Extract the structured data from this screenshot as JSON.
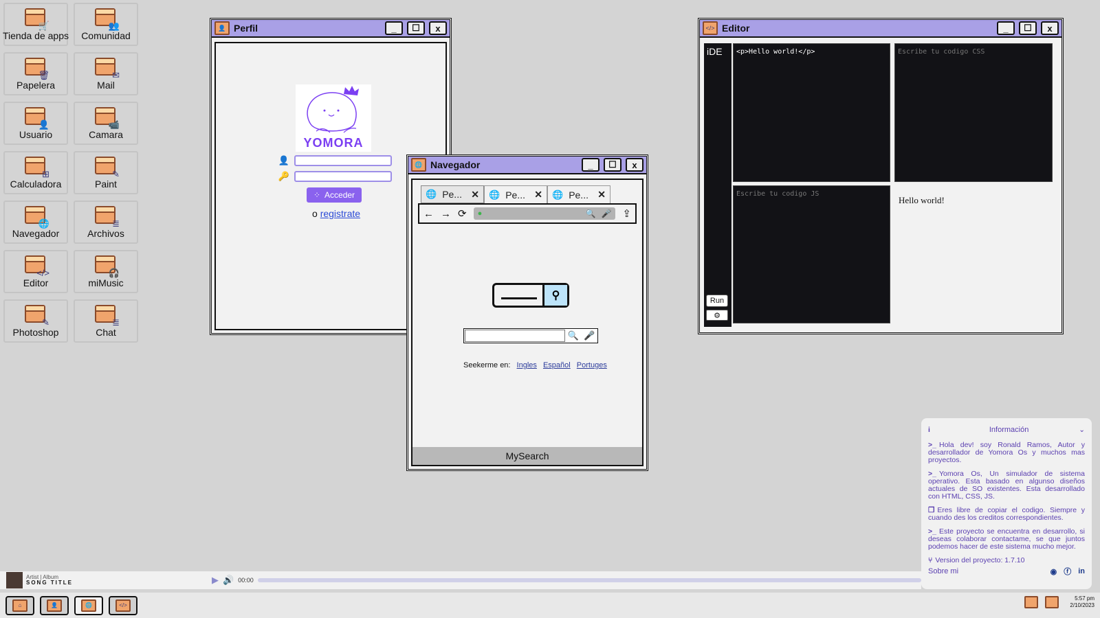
{
  "desktop": {
    "icons": [
      {
        "label": "Tienda de apps",
        "icon": "cart-icon",
        "glyph": "🛒"
      },
      {
        "label": "Comunidad",
        "icon": "community-icon",
        "glyph": "👥"
      },
      {
        "label": "Papelera",
        "icon": "trash-icon",
        "glyph": "🗑"
      },
      {
        "label": "Mail",
        "icon": "mail-icon",
        "glyph": "✉"
      },
      {
        "label": "Usuario",
        "icon": "user-icon",
        "glyph": "👤"
      },
      {
        "label": "Camara",
        "icon": "camera-icon",
        "glyph": "📹"
      },
      {
        "label": "Calculadora",
        "icon": "calculator-icon",
        "glyph": "⊞"
      },
      {
        "label": "Paint",
        "icon": "paint-icon",
        "glyph": "✎"
      },
      {
        "label": "Navegador",
        "icon": "browser-icon",
        "glyph": "🌐"
      },
      {
        "label": "Archivos",
        "icon": "files-icon",
        "glyph": "≣"
      },
      {
        "label": "Editor",
        "icon": "code-icon",
        "glyph": "</>"
      },
      {
        "label": "miMusic",
        "icon": "headphones-icon",
        "glyph": "🎧"
      },
      {
        "label": "Photoshop",
        "icon": "brush-icon",
        "glyph": "✎"
      },
      {
        "label": "Chat",
        "icon": "chat-icon",
        "glyph": "≣"
      }
    ]
  },
  "perfil": {
    "title": "Perfil",
    "logo_text": "YOMORA",
    "login_button": "Acceder",
    "register_prefix": "o",
    "register_link": "registrate"
  },
  "navegador": {
    "title": "Navegador",
    "tabs": [
      "Pe...",
      "Pe...",
      "Pe..."
    ],
    "seek_label": "Seekerme en:",
    "languages": [
      "Ingles",
      "Español",
      "Portuges"
    ],
    "footer": "MySearch"
  },
  "editor": {
    "title": "Editor",
    "sidebar_label": "iDE",
    "html_code": "<p>Hello world!</p>",
    "css_placeholder": "Escribe tu codigo CSS",
    "js_placeholder": "Escribe tu codigo JS",
    "preview_text": "Hello world!",
    "run_label": "Run"
  },
  "info": {
    "title": "Información",
    "paragraphs": [
      "Hola dev! soy Ronald Ramos, Autor y desarrollador de Yomora Os y muchos mas proyectos.",
      "Yomora Os, Un simulador de sistema operativo. Esta basado en algunso diseños actuales de SO existentes. Esta desarrollado con HTML, CSS, JS.",
      "Eres libre de copiar el codigo. Siempre y cuando des los creditos correspondientes.",
      "Este proyecto se encuentra en desarrollo, si deseas colaborar contactame, se que juntos podemos hacer de este sistema mucho mejor."
    ],
    "version": "Version del proyecto: 1.7.10",
    "about": "Sobre mi"
  },
  "music": {
    "artist_album": "Artist | Album",
    "song_title": "SONG TITLE",
    "time": "00:00",
    "progress": 0
  },
  "taskbar": {
    "time": "5:57 pm",
    "date": "2/10/2023"
  },
  "colors": {
    "titlebar": "#a9a0e6",
    "accent": "#8a62ee",
    "icon_orange": "#f0a46c"
  }
}
